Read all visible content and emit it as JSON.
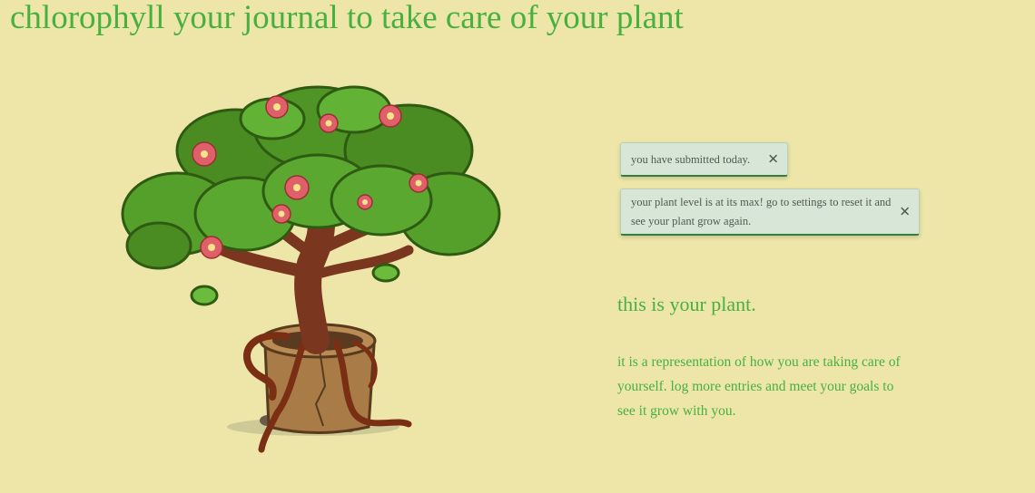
{
  "header": {
    "title": "chlorophyll your journal to take care of your plant"
  },
  "plant": {
    "image_icon": "bonsai-tree-with-red-flowers"
  },
  "notifications": [
    {
      "message": "you have submitted today.",
      "close_label": "✕"
    },
    {
      "message": "your plant level is at its max! go to settings to reset it and see your plant grow again.",
      "close_label": "✕"
    }
  ],
  "main": {
    "heading": "this is your plant.",
    "description": "it is a representation of how you are taking care of yourself. log more entries and meet your goals to see it grow with you."
  },
  "colors": {
    "background": "#ede6a8",
    "accent": "#47b040",
    "toast_background": "#d8e6d8",
    "toast_border": "#2f7f3f"
  }
}
